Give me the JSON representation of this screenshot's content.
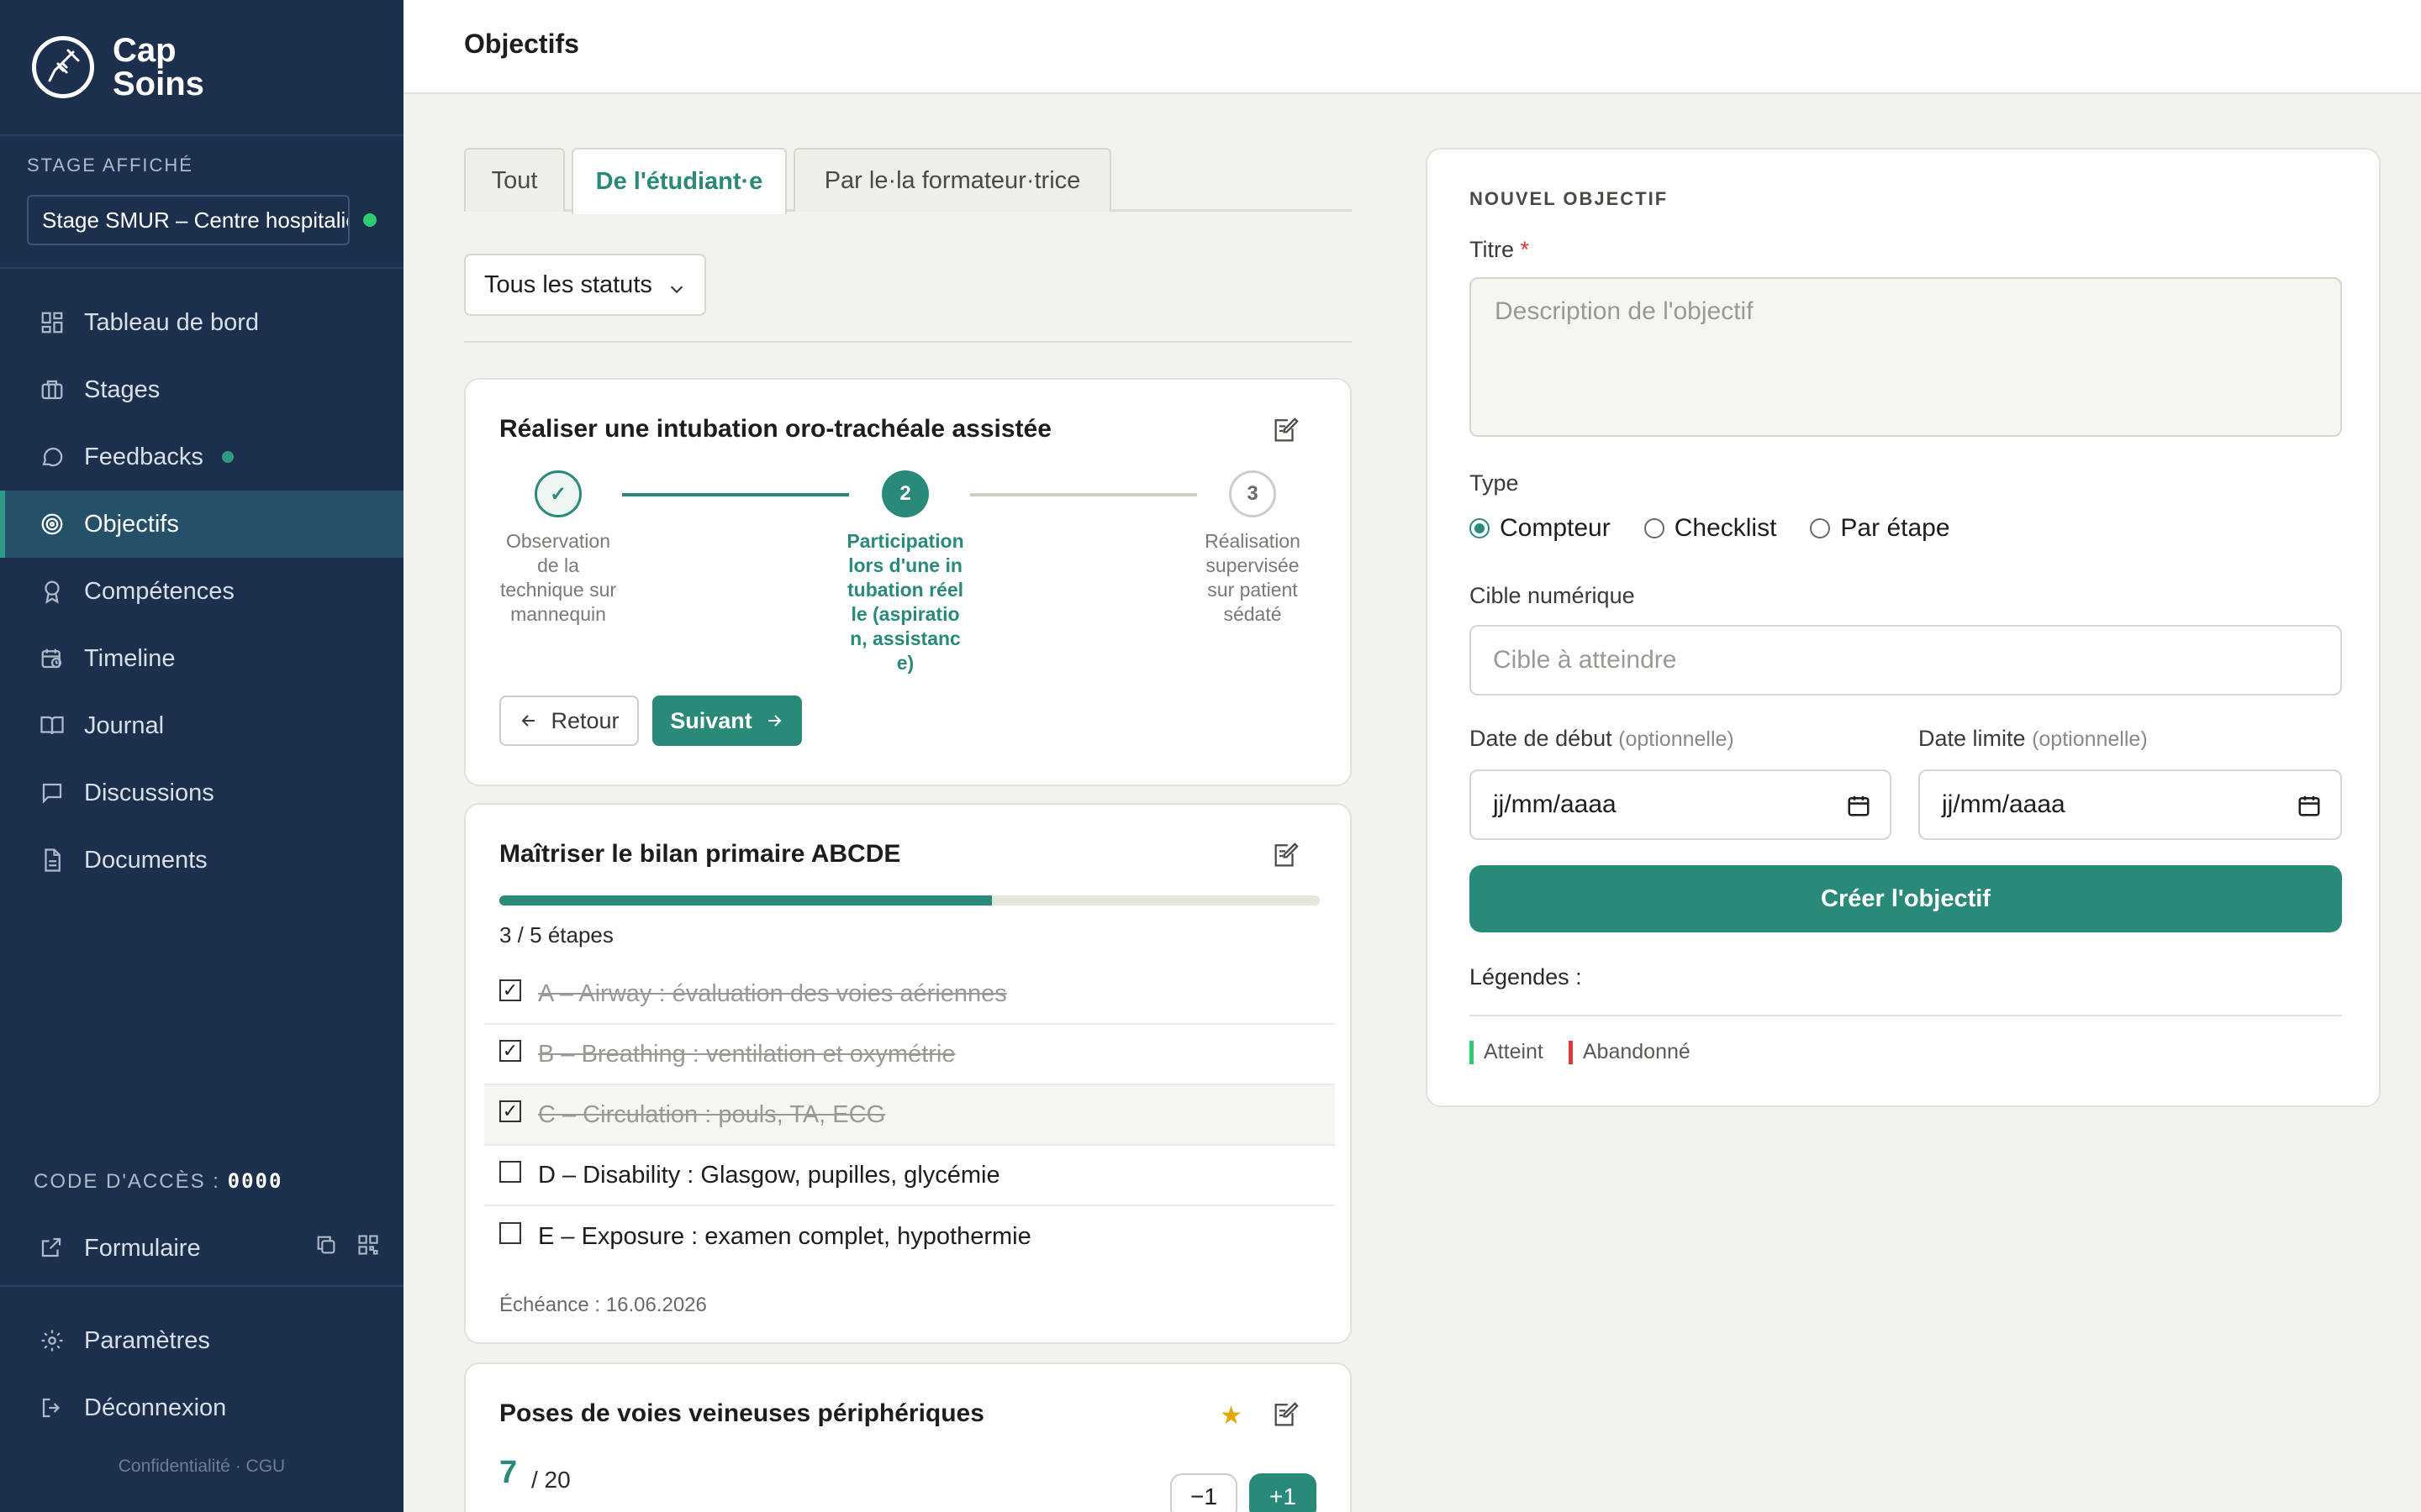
{
  "brand": {
    "line1": "Cap",
    "line2": "Soins"
  },
  "sidebar": {
    "stage_label": "STAGE AFFICHÉ",
    "stage_value": "Stage SMUR – Centre hospitalier",
    "items": [
      {
        "label": "Tableau de bord",
        "icon": "dashboard-icon"
      },
      {
        "label": "Stages",
        "icon": "briefcase-icon"
      },
      {
        "label": "Feedbacks",
        "icon": "chat-bubble-icon"
      },
      {
        "label": "Objectifs",
        "icon": "target-icon"
      },
      {
        "label": "Compétences",
        "icon": "award-icon"
      },
      {
        "label": "Timeline",
        "icon": "calendar-clock-icon"
      },
      {
        "label": "Journal",
        "icon": "book-icon"
      },
      {
        "label": "Discussions",
        "icon": "message-square-icon"
      },
      {
        "label": "Documents",
        "icon": "document-icon"
      }
    ],
    "access_label": "CODE D'ACCÈS :",
    "access_code": "0000",
    "form_label": "Formulaire",
    "settings_label": "Paramètres",
    "logout_label": "Déconnexion",
    "legal_privacy": "Confidentialité",
    "legal_sep": "·",
    "legal_terms": "CGU"
  },
  "header": {
    "title": "Objectifs"
  },
  "tabs": [
    "Tout",
    "De l'étudiant·e",
    "Par le·la formateur·trice"
  ],
  "status_filter": "Tous les statuts",
  "cards": {
    "stepper": {
      "title": "Réaliser une intubation oro-trachéale assistée",
      "steps": [
        {
          "num": "✓",
          "label": "Observation de la technique sur mannequin"
        },
        {
          "num": "2",
          "label": "Participation lors d'une intubation réelle (aspiration, assistance)"
        },
        {
          "num": "3",
          "label": "Réalisation supervisée sur patient sédaté"
        }
      ],
      "back_label": "Retour",
      "next_label": "Suivant"
    },
    "checklist": {
      "title": "Maîtriser le bilan primaire ABCDE",
      "progress": 0.6,
      "steps_text": "3 / 5 étapes",
      "items": [
        {
          "text": "A – Airway : évaluation des voies aériennes",
          "done": true
        },
        {
          "text": "B – Breathing : ventilation et oxymétrie",
          "done": true
        },
        {
          "text": "C – Circulation : pouls, TA, ECG",
          "done": true
        },
        {
          "text": "D – Disability : Glasgow, pupilles, glycémie",
          "done": false
        },
        {
          "text": "E – Exposure : examen complet, hypothermie",
          "done": false
        }
      ],
      "due": "Échéance : 16.06.2026"
    },
    "counter": {
      "title": "Poses de voies veineuses périphériques",
      "value": "7",
      "target": "/ 20",
      "minus_label": "−1",
      "plus_label": "+1"
    }
  },
  "new_objective": {
    "section_title": "NOUVEL OBJECTIF",
    "title_label": "Titre",
    "required_mark": "*",
    "title_placeholder": "Description de l'objectif",
    "type_label": "Type",
    "types": [
      "Compteur",
      "Checklist",
      "Par étape"
    ],
    "target_label": "Cible numérique",
    "target_placeholder": "Cible à atteindre",
    "start_label": "Date de début",
    "end_label": "Date limite",
    "optional": "(optionnelle)",
    "date_placeholder": "jj/mm/aaaa",
    "create_label": "Créer l'objectif",
    "legend_label": "Légendes :",
    "legend": [
      {
        "label": "Atteint",
        "color": "#2ecc71"
      },
      {
        "label": "Abandonné",
        "color": "#e03b3b"
      }
    ]
  },
  "colors": {
    "accent": "#2a8a79",
    "sidebar": "#1c2f4d"
  }
}
